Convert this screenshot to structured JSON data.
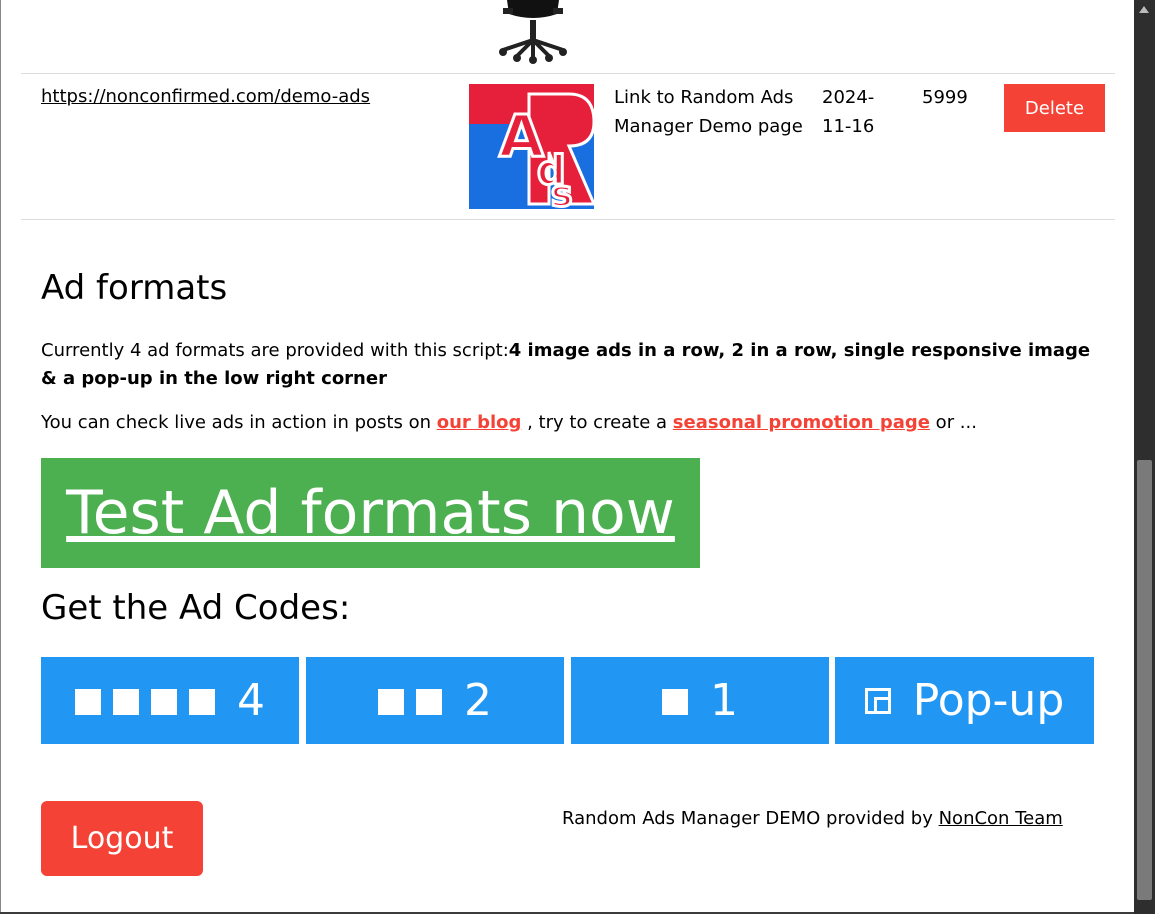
{
  "ad_row": {
    "url": "https://nonconfirmed.com/demo-ads",
    "description": "Link to Random Ads Manager Demo page",
    "date": "2024-11-16",
    "clicks": "5999",
    "delete_label": "Delete"
  },
  "ad_formats": {
    "heading": "Ad formats",
    "intro": "Currently 4 ad formats are provided with this script:",
    "intro_bold": "4 image ads in a row, 2 in a row, single responsive image & a pop-up in the low right corner",
    "live_prefix": "You can check live ads in action in posts on ",
    "blog_link": "our blog",
    "live_middle": " , try to create a ",
    "promo_link": "seasonal promotion page",
    "live_suffix": " or ...",
    "test_button": "Test Ad formats now"
  },
  "ad_codes": {
    "heading": "Get the Ad Codes:",
    "buttons": [
      {
        "label": "4",
        "icon": "four-squares-icon"
      },
      {
        "label": "2",
        "icon": "two-squares-icon"
      },
      {
        "label": "1",
        "icon": "one-square-icon"
      },
      {
        "label": "Pop-up",
        "icon": "popup-corner-icon"
      }
    ]
  },
  "footer": {
    "logout_label": "Logout",
    "credit_prefix": "Random Ads Manager DEMO provided by ",
    "credit_link": "NonCon Team"
  },
  "colors": {
    "red": "#f44336",
    "green": "#4caf50",
    "blue": "#2196f3"
  }
}
